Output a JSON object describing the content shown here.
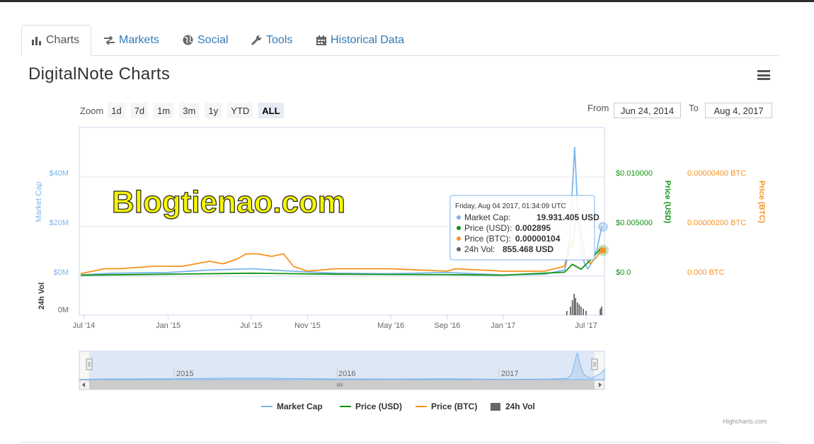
{
  "tabs": [
    {
      "label": "Charts",
      "icon": "bar-chart-icon"
    },
    {
      "label": "Markets",
      "icon": "exchange-icon"
    },
    {
      "label": "Social",
      "icon": "globe-icon"
    },
    {
      "label": "Tools",
      "icon": "wrench-icon"
    },
    {
      "label": "Historical Data",
      "icon": "calendar-icon"
    }
  ],
  "page": {
    "title": "DigitalNote Charts"
  },
  "zoom": {
    "label": "Zoom",
    "buttons": [
      "1d",
      "7d",
      "1m",
      "3m",
      "1y",
      "YTD",
      "ALL"
    ],
    "selected": "ALL"
  },
  "range": {
    "from_label": "From",
    "from_value": "Jun 24, 2014",
    "to_label": "To",
    "to_value": "Aug 4, 2017"
  },
  "watermark": "Blogtienao.com",
  "chart_data": {
    "type": "line",
    "axes": {
      "market_cap": {
        "title": "Market Cap",
        "ticks": [
          "$40M",
          "$20M",
          "$0M"
        ],
        "color": "#7cb5ec"
      },
      "price_usd": {
        "title": "Price (USD)",
        "ticks": [
          "$0.010000",
          "$0.005000",
          "$0.0"
        ],
        "color": "#119411"
      },
      "price_btc": {
        "title": "Price (BTC)",
        "ticks": [
          "0.00000400 BTC",
          "0.00000200 BTC",
          "0.000 BTC"
        ],
        "color": "#f7921e"
      },
      "volume": {
        "title": "24h Vol",
        "ticks": [
          "0M"
        ]
      }
    },
    "x_ticks": [
      "Jul '14",
      "Jan '15",
      "Jul '15",
      "Nov '15",
      "May '16",
      "Sep '16",
      "Jan '17",
      "Jul '17"
    ],
    "navigator_ticks": [
      "2015",
      "2016",
      "2017"
    ],
    "series": [
      {
        "name": "Market Cap",
        "color": "#7cb5ec",
        "x": [
          "2014-06-24",
          "2014-09-01",
          "2015-01-01",
          "2015-04-01",
          "2015-07-01",
          "2015-10-01",
          "2016-01-01",
          "2016-05-01",
          "2016-09-01",
          "2017-01-01",
          "2017-04-01",
          "2017-05-15",
          "2017-05-25",
          "2017-06-01",
          "2017-06-06",
          "2017-06-12",
          "2017-06-20",
          "2017-06-28",
          "2017-07-05",
          "2017-07-15",
          "2017-07-25",
          "2017-08-04"
        ],
        "values": [
          0.5,
          1.2,
          1.5,
          2.5,
          3.0,
          2.0,
          1.2,
          1.0,
          1.5,
          0.5,
          0.8,
          2.5,
          10,
          35,
          52,
          30,
          10,
          5,
          3,
          6,
          11,
          19.93
        ]
      },
      {
        "name": "Price (USD)",
        "color": "#119411",
        "x": [
          "2014-06-24",
          "2015-01-01",
          "2015-07-01",
          "2016-01-01",
          "2016-09-01",
          "2017-01-01",
          "2017-05-15",
          "2017-06-01",
          "2017-06-20",
          "2017-07-10",
          "2017-08-04"
        ],
        "values": [
          0.0001,
          0.0002,
          0.0003,
          0.0002,
          0.00015,
          0.0001,
          0.0004,
          0.0012,
          0.0007,
          0.0016,
          0.002895
        ]
      },
      {
        "name": "Price (BTC)",
        "color": "#f7921e",
        "x": [
          "2014-06-24",
          "2014-08-15",
          "2014-09-15",
          "2014-12-01",
          "2015-02-01",
          "2015-04-01",
          "2015-05-01",
          "2015-06-01",
          "2015-06-20",
          "2015-07-15",
          "2015-08-15",
          "2015-09-10",
          "2015-10-01",
          "2015-11-01",
          "2016-01-01",
          "2016-05-01",
          "2016-09-01",
          "2016-09-20",
          "2017-01-01",
          "2017-04-01",
          "2017-05-15",
          "2017-05-25",
          "2017-06-01",
          "2017-06-10",
          "2017-06-20",
          "2017-06-28",
          "2017-07-10",
          "2017-07-25",
          "2017-08-04"
        ],
        "values": [
          1e-07,
          3e-07,
          3e-07,
          4e-07,
          4e-07,
          6e-07,
          5e-07,
          7e-07,
          9e-07,
          9e-07,
          8e-07,
          9e-07,
          4e-07,
          2e-07,
          3e-07,
          3e-07,
          2e-07,
          3e-07,
          2e-07,
          2e-07,
          4e-07,
          1.3e-06,
          1.2e-06,
          2.5e-06,
          1.8e-06,
          8e-07,
          5e-07,
          8e-07,
          1.04e-06
        ]
      },
      {
        "name": "24h Vol",
        "color": "#555555",
        "x": [
          "2017-05-20",
          "2017-05-28",
          "2017-06-01",
          "2017-06-05",
          "2017-06-08",
          "2017-06-12",
          "2017-06-16",
          "2017-06-20",
          "2017-06-25",
          "2017-07-01",
          "2017-08-01",
          "2017-08-04"
        ],
        "values": [
          0.2,
          0.4,
          0.7,
          1.0,
          0.8,
          0.6,
          0.5,
          0.4,
          0.3,
          0.2,
          0.3,
          0.4
        ]
      }
    ],
    "tooltip": {
      "header": "Friday, Aug 04 2017, 01:34:09 UTC",
      "rows": [
        {
          "label": "Market Cap:",
          "value": "19.931.405 USD",
          "color": "#7cb5ec"
        },
        {
          "label": "Price (USD):",
          "value": "0.002895",
          "color": "#119411"
        },
        {
          "label": "Price (BTC):",
          "value": "0.00000104",
          "color": "#f7921e"
        },
        {
          "label": "24h Vol:",
          "value": "855.468 USD",
          "color": "#666666"
        }
      ]
    },
    "legend": [
      {
        "label": "Market Cap",
        "color": "#7cb5ec",
        "marker": "line"
      },
      {
        "label": "Price (USD)",
        "color": "#119411",
        "marker": "line"
      },
      {
        "label": "Price (BTC)",
        "color": "#f7921e",
        "marker": "line"
      },
      {
        "label": "24h Vol",
        "color": "#666666",
        "marker": "square"
      }
    ],
    "credit": "Highcharts.com"
  }
}
